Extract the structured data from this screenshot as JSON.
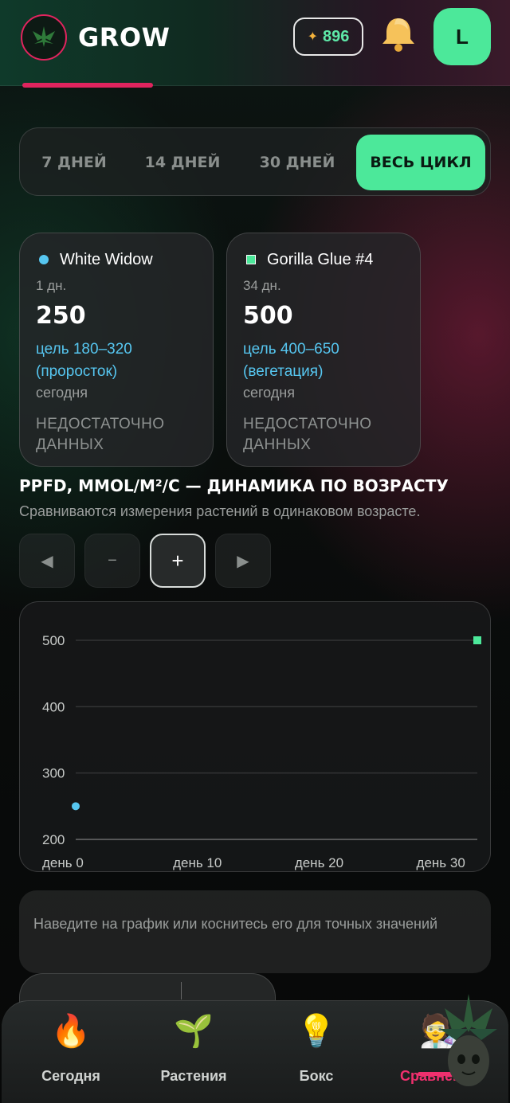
{
  "header": {
    "logo_text": "GROW",
    "coins": "896",
    "avatar_letter": "L"
  },
  "periods": [
    {
      "label": "7 ДНЕЙ",
      "active": false
    },
    {
      "label": "14 ДНЕЙ",
      "active": false
    },
    {
      "label": "30 ДНЕЙ",
      "active": false
    },
    {
      "label": "ВЕСЬ ЦИКЛ",
      "active": true
    }
  ],
  "plants": [
    {
      "name": "White Widow",
      "marker": "circle",
      "color": "#56c6f0",
      "age": "1 дн.",
      "value": "250",
      "target": "цель 180–320 (проросток)",
      "when": "сегодня",
      "status": "НЕДОСТАТОЧНО ДАННЫХ"
    },
    {
      "name": "Gorilla Glue #4",
      "marker": "square",
      "color": "#4ce89a",
      "age": "34 дн.",
      "value": "500",
      "target": "цель 400–650 (вегетация)",
      "when": "сегодня",
      "status": "НЕДОСТАТОЧНО ДАННЫХ"
    }
  ],
  "chart_section": {
    "title": "PPFD, MMOL/M²/С — ДИНАМИКА ПО ВОЗРАСТУ",
    "subtitle": "Сравниваются измерения растений в одинаковом возрасте."
  },
  "chart_controls": [
    {
      "name": "pan-left-button",
      "label": "◀",
      "active": false
    },
    {
      "name": "zoom-out-button",
      "label": "−",
      "active": false
    },
    {
      "name": "zoom-in-button",
      "label": "+",
      "active": true
    },
    {
      "name": "pan-right-button",
      "label": "▶",
      "active": false
    }
  ],
  "chart_data": {
    "type": "scatter",
    "title": "",
    "xlabel": "",
    "ylabel": "",
    "x_tick_labels": [
      "день 0",
      "день 10",
      "день 20",
      "день 30"
    ],
    "x_ticks": [
      0,
      10,
      20,
      30
    ],
    "y_ticks": [
      200,
      300,
      400,
      500
    ],
    "xlim": [
      0,
      33
    ],
    "ylim": [
      200,
      500
    ],
    "grid": true,
    "series": [
      {
        "name": "White Widow",
        "color": "#56c6f0",
        "marker": "circle",
        "points": [
          {
            "x": 0,
            "y": 250
          }
        ]
      },
      {
        "name": "Gorilla Glue #4",
        "color": "#4ce89a",
        "marker": "square",
        "points": [
          {
            "x": 33,
            "y": 500
          }
        ]
      }
    ]
  },
  "hint": "Наведите на график или коснитесь его для точных значений",
  "nav": [
    {
      "label": "Сегодня",
      "icon": "fire-icon",
      "glyph": "🔥",
      "active": false
    },
    {
      "label": "Растения",
      "icon": "seedling-icon",
      "glyph": "🌱",
      "active": false
    },
    {
      "label": "Бокс",
      "icon": "lightbulb-icon",
      "glyph": "💡",
      "active": false
    },
    {
      "label": "Сравнение",
      "icon": "compare-icon",
      "glyph": "🧑‍🔬",
      "active": true
    }
  ],
  "colors": {
    "accent_green": "#4ce89a",
    "accent_pink": "#f0306e",
    "series_blue": "#56c6f0"
  }
}
